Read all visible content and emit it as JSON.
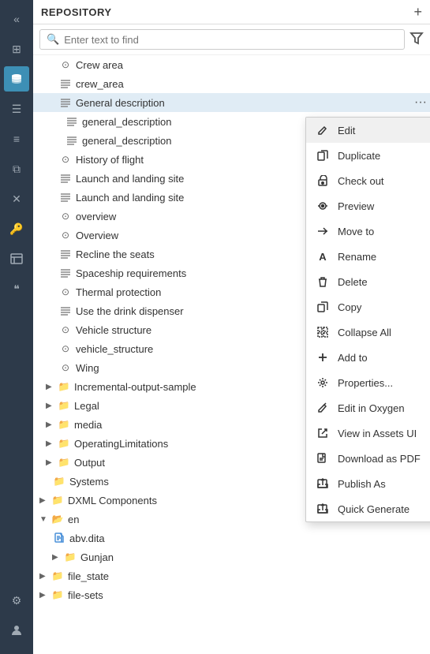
{
  "sidebar": {
    "icons": [
      {
        "name": "chevron-double-left-icon",
        "symbol": "«",
        "active": false
      },
      {
        "name": "grid-icon",
        "symbol": "⊞",
        "active": false
      },
      {
        "name": "database-icon",
        "symbol": "🗄",
        "active": true
      },
      {
        "name": "list-icon",
        "symbol": "☰",
        "active": false
      },
      {
        "name": "list-nested-icon",
        "symbol": "≡",
        "active": false
      },
      {
        "name": "layers-icon",
        "symbol": "⧉",
        "active": false
      },
      {
        "name": "x-icon",
        "symbol": "✕",
        "active": false
      },
      {
        "name": "key-icon",
        "symbol": "🔑",
        "active": false
      },
      {
        "name": "table-icon",
        "symbol": "⊞",
        "active": false
      },
      {
        "name": "quote-icon",
        "symbol": "❝",
        "active": false
      },
      {
        "name": "gear-icon",
        "symbol": "⚙",
        "active": false
      },
      {
        "name": "person-icon",
        "symbol": "👤",
        "active": false
      }
    ]
  },
  "header": {
    "title": "REPOSITORY",
    "add_label": "+"
  },
  "search": {
    "placeholder": "Enter text to find"
  },
  "tree": {
    "items": [
      {
        "id": 1,
        "indent": 24,
        "type": "para",
        "label": "Crew area",
        "has_chevron": false,
        "selected": false
      },
      {
        "id": 2,
        "indent": 24,
        "type": "para",
        "label": "crew_area",
        "has_chevron": false,
        "selected": false
      },
      {
        "id": 3,
        "indent": 24,
        "type": "doc",
        "label": "General description",
        "has_chevron": false,
        "selected": true
      },
      {
        "id": 4,
        "indent": 32,
        "type": "doc",
        "label": "general_description",
        "has_chevron": false,
        "selected": false
      },
      {
        "id": 5,
        "indent": 32,
        "type": "doc",
        "label": "general_description",
        "has_chevron": false,
        "selected": false
      },
      {
        "id": 6,
        "indent": 24,
        "type": "para",
        "label": "History of flight",
        "has_chevron": false,
        "selected": false
      },
      {
        "id": 7,
        "indent": 24,
        "type": "doc",
        "label": "Launch and landing site",
        "has_chevron": false,
        "selected": false
      },
      {
        "id": 8,
        "indent": 24,
        "type": "doc",
        "label": "Launch and landing site",
        "has_chevron": false,
        "selected": false
      },
      {
        "id": 9,
        "indent": 24,
        "type": "para",
        "label": "overview",
        "has_chevron": false,
        "selected": false
      },
      {
        "id": 10,
        "indent": 24,
        "type": "para",
        "label": "Overview",
        "has_chevron": false,
        "selected": false
      },
      {
        "id": 11,
        "indent": 24,
        "type": "doc",
        "label": "Recline the seats",
        "has_chevron": false,
        "selected": false
      },
      {
        "id": 12,
        "indent": 24,
        "type": "doc",
        "label": "Spaceship requirements",
        "has_chevron": false,
        "selected": false
      },
      {
        "id": 13,
        "indent": 24,
        "type": "para",
        "label": "Thermal protection",
        "has_chevron": false,
        "selected": false
      },
      {
        "id": 14,
        "indent": 24,
        "type": "doc",
        "label": "Use the drink dispenser",
        "has_chevron": false,
        "selected": false
      },
      {
        "id": 15,
        "indent": 24,
        "type": "para",
        "label": "Vehicle structure",
        "has_chevron": false,
        "selected": false
      },
      {
        "id": 16,
        "indent": 24,
        "type": "para",
        "label": "vehicle_structure",
        "has_chevron": false,
        "selected": false
      },
      {
        "id": 17,
        "indent": 24,
        "type": "para",
        "label": "Wing",
        "has_chevron": false,
        "selected": false
      },
      {
        "id": 18,
        "indent": 8,
        "type": "folder",
        "label": "Incremental-output-sample",
        "has_chevron": true,
        "chevron_dir": "right",
        "selected": false
      },
      {
        "id": 19,
        "indent": 8,
        "type": "folder",
        "label": "Legal",
        "has_chevron": true,
        "chevron_dir": "right",
        "selected": false
      },
      {
        "id": 20,
        "indent": 8,
        "type": "folder",
        "label": "media",
        "has_chevron": true,
        "chevron_dir": "right",
        "selected": false
      },
      {
        "id": 21,
        "indent": 8,
        "type": "folder",
        "label": "OperatingLimitations",
        "has_chevron": true,
        "chevron_dir": "right",
        "selected": false
      },
      {
        "id": 22,
        "indent": 8,
        "type": "folder",
        "label": "Output",
        "has_chevron": true,
        "chevron_dir": "right",
        "selected": false
      },
      {
        "id": 23,
        "indent": 8,
        "type": "folder",
        "label": "Systems",
        "has_chevron": false,
        "selected": false
      },
      {
        "id": 24,
        "indent": 0,
        "type": "folder",
        "label": "DXML Components",
        "has_chevron": true,
        "chevron_dir": "right",
        "selected": false
      },
      {
        "id": 25,
        "indent": 0,
        "type": "folder",
        "label": "en",
        "has_chevron": true,
        "chevron_dir": "down",
        "selected": false
      },
      {
        "id": 26,
        "indent": 16,
        "type": "file",
        "label": "abv.dita",
        "has_chevron": false,
        "selected": false
      },
      {
        "id": 27,
        "indent": 16,
        "type": "folder",
        "label": "Gunjan",
        "has_chevron": true,
        "chevron_dir": "right",
        "selected": false
      },
      {
        "id": 28,
        "indent": 0,
        "type": "folder",
        "label": "file_state",
        "has_chevron": true,
        "chevron_dir": "right",
        "selected": false
      },
      {
        "id": 29,
        "indent": 0,
        "type": "folder",
        "label": "file-sets",
        "has_chevron": true,
        "chevron_dir": "right",
        "selected": false
      }
    ]
  },
  "context_menu": {
    "items": [
      {
        "id": "edit",
        "label": "Edit",
        "icon": "pencil",
        "has_arrow": false,
        "highlighted": true
      },
      {
        "id": "duplicate",
        "label": "Duplicate",
        "icon": "duplicate",
        "has_arrow": false
      },
      {
        "id": "checkout",
        "label": "Check out",
        "icon": "lock",
        "has_arrow": false
      },
      {
        "id": "preview",
        "label": "Preview",
        "icon": "preview",
        "has_arrow": false
      },
      {
        "id": "move-to",
        "label": "Move to",
        "icon": "move",
        "has_arrow": false
      },
      {
        "id": "rename",
        "label": "Rename",
        "icon": "rename",
        "has_arrow": false
      },
      {
        "id": "delete",
        "label": "Delete",
        "icon": "trash",
        "has_arrow": false
      },
      {
        "id": "copy",
        "label": "Copy",
        "icon": "copy",
        "has_arrow": true
      },
      {
        "id": "collapse-all",
        "label": "Collapse All",
        "icon": "collapse",
        "has_arrow": false
      },
      {
        "id": "add-to",
        "label": "Add to",
        "icon": "add",
        "has_arrow": true
      },
      {
        "id": "properties",
        "label": "Properties...",
        "icon": "properties",
        "has_arrow": false
      },
      {
        "id": "edit-oxygen",
        "label": "Edit in Oxygen",
        "icon": "edit-oxygen",
        "has_arrow": false
      },
      {
        "id": "view-assets",
        "label": "View in Assets UI",
        "icon": "view-assets",
        "has_arrow": false
      },
      {
        "id": "download-pdf",
        "label": "Download as PDF",
        "icon": "download",
        "has_arrow": false
      },
      {
        "id": "publish-as",
        "label": "Publish As",
        "icon": "publish",
        "has_arrow": true
      },
      {
        "id": "quick-generate",
        "label": "Quick Generate",
        "icon": "quick-generate",
        "has_arrow": true
      }
    ]
  }
}
